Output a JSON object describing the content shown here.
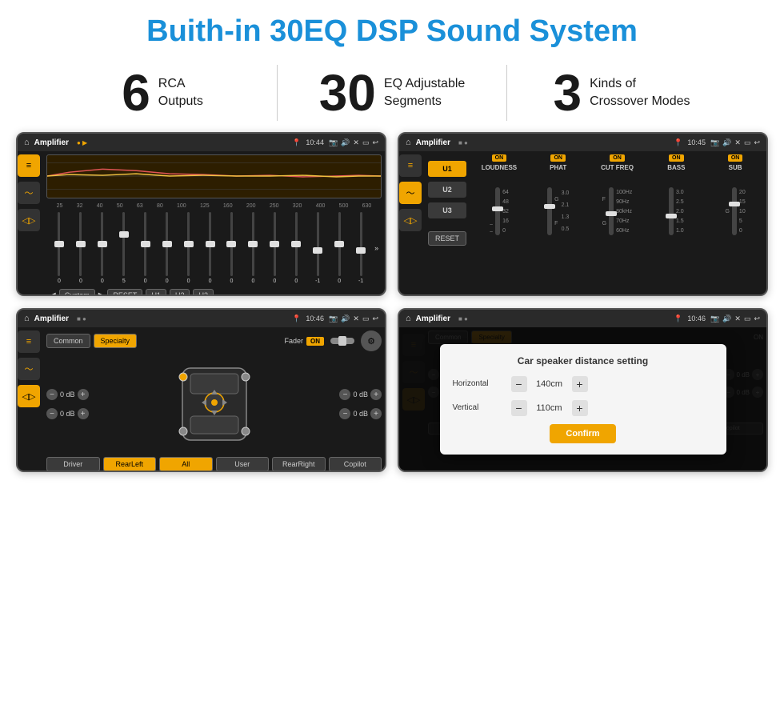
{
  "page": {
    "title": "Buith-in 30EQ DSP Sound System"
  },
  "stats": [
    {
      "number": "6",
      "line1": "RCA",
      "line2": "Outputs"
    },
    {
      "number": "30",
      "line1": "EQ Adjustable",
      "line2": "Segments"
    },
    {
      "number": "3",
      "line1": "Kinds of",
      "line2": "Crossover Modes"
    }
  ],
  "screens": [
    {
      "id": "eq-screen",
      "status": {
        "title": "Amplifier",
        "time": "10:44"
      },
      "type": "eq"
    },
    {
      "id": "crossover-screen",
      "status": {
        "title": "Amplifier",
        "time": "10:45"
      },
      "type": "crossover"
    },
    {
      "id": "speaker-screen",
      "status": {
        "title": "Amplifier",
        "time": "10:46"
      },
      "type": "speaker"
    },
    {
      "id": "distance-screen",
      "status": {
        "title": "Amplifier",
        "time": "10:46"
      },
      "type": "distance"
    }
  ],
  "eq": {
    "frequencies": [
      "25",
      "32",
      "40",
      "50",
      "63",
      "80",
      "100",
      "125",
      "160",
      "200",
      "250",
      "320",
      "400",
      "500",
      "630"
    ],
    "values": [
      "0",
      "0",
      "0",
      "5",
      "0",
      "0",
      "0",
      "0",
      "0",
      "0",
      "0",
      "0",
      "-1",
      "0",
      "-1"
    ],
    "controls": [
      "Custom",
      "RESET",
      "U1",
      "U2",
      "U3"
    ]
  },
  "crossover": {
    "sections": [
      "LOUDNESS",
      "PHAT",
      "CUT FREQ",
      "BASS",
      "SUB"
    ],
    "u_buttons": [
      "U1",
      "U2",
      "U3"
    ],
    "reset_label": "RESET"
  },
  "speaker": {
    "tabs": [
      "Common",
      "Specialty"
    ],
    "fader_label": "Fader",
    "fader_on": "ON",
    "vol_labels": [
      "0 dB",
      "0 dB",
      "0 dB",
      "0 dB"
    ],
    "bottom_buttons": [
      "Driver",
      "RearLeft",
      "All",
      "User",
      "RearRight",
      "Copilot"
    ]
  },
  "distance_dialog": {
    "title": "Car speaker distance setting",
    "horizontal_label": "Horizontal",
    "horizontal_value": "140cm",
    "vertical_label": "Vertical",
    "vertical_value": "110cm",
    "confirm_label": "Confirm"
  }
}
